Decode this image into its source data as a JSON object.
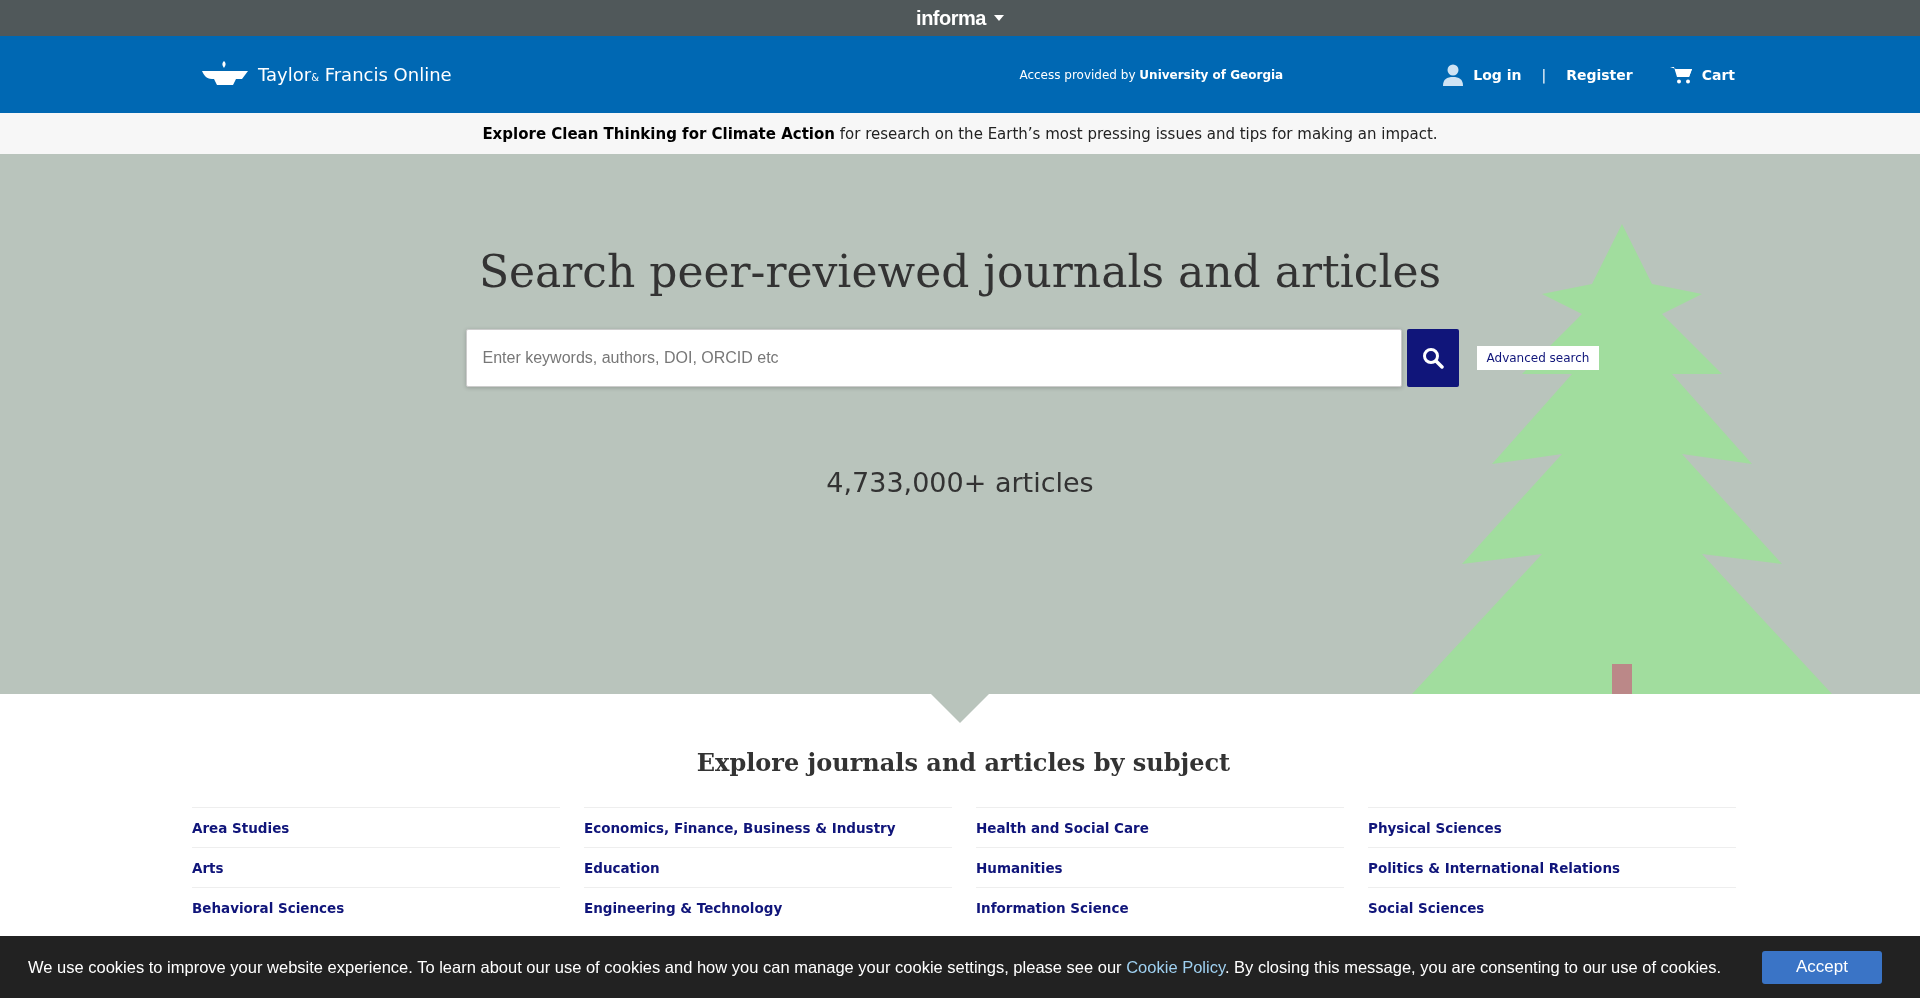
{
  "top_bar": {
    "brand": "informa"
  },
  "header": {
    "logo": {
      "part_1": "Taylor",
      "amp": "&",
      "part_2": "Francis Online"
    },
    "access": "Access provided by **University of Georgia**",
    "login": "Log in",
    "separator": "|",
    "register": "Register",
    "cart": "Cart"
  },
  "banner": {
    "text": "**Explore Clean Thinking for Climate Action** for research on the Earth’s most pressing issues and tips for making an impact."
  },
  "hero": {
    "title": "Search peer-reviewed journals and articles",
    "search": {
      "placeholder": "Enter keywords, authors, DOI, ORCID etc"
    },
    "advanced_search": "Advanced search",
    "count": "4,733,000+ articles"
  },
  "subjects": {
    "title": "Explore journals and articles by subject",
    "columns": [
      [
        "Area Studies",
        "Arts",
        "Behavioral Sciences"
      ],
      [
        "Economics, Finance, Business & Industry",
        "Education",
        "Engineering & Technology"
      ],
      [
        "Health and Social Care",
        "Humanities",
        "Information Science"
      ],
      [
        "Physical Sciences",
        "Politics & International Relations",
        "Social Sciences"
      ]
    ]
  },
  "cookie_bar": {
    "text_before": "We use cookies to improve your website experience. To learn about our use of cookies and how you can manage your cookie settings, please see our",
    "link": "Cookie Policy",
    "text_after": ". By closing this message, you are consenting to our use of cookies.",
    "accept": "Accept"
  }
}
